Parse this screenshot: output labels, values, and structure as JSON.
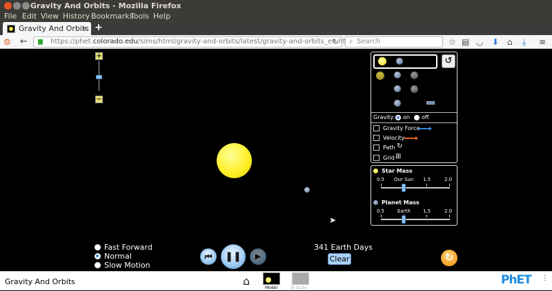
{
  "window": {
    "title": "Gravity And Orbits - Mozilla Firefox"
  },
  "menu": [
    "File",
    "Edit",
    "View",
    "History",
    "Bookmarks",
    "Tools",
    "Help"
  ],
  "tab": {
    "label": "Gravity And Orbits",
    "close": "×",
    "new_tab": "+"
  },
  "address": {
    "prefix": "https://phet.",
    "domain": "colorado.edu",
    "path": "/sims/html/gravity-and-orbits/latest/gravity-and-orbits_en.html",
    "reload": "↻"
  },
  "search": {
    "placeholder": "Search"
  },
  "zoom": {
    "plus": "+",
    "minus": "−"
  },
  "controls": {
    "gravity_label": "Gravity:",
    "gravity_on": "on",
    "gravity_off": "off",
    "gravity_value": "on",
    "checkboxes": [
      {
        "label": "Gravity Force",
        "color": "#3a86d8"
      },
      {
        "label": "Velocity",
        "color": "#e2601a"
      },
      {
        "label": "Path",
        "icon": "path-icon"
      },
      {
        "label": "Grid",
        "icon": "grid-icon"
      }
    ],
    "reset_symbol": "↺"
  },
  "mass": {
    "star_title": "Star Mass",
    "star_ticks": [
      "0.5",
      "Our Sun",
      "1.5",
      "2.0"
    ],
    "star_value": 1.0,
    "planet_title": "Planet Mass",
    "planet_ticks": [
      "0.5",
      "Earth",
      "1.5",
      "2.0"
    ],
    "planet_value": 1.0
  },
  "speed": {
    "options": [
      "Fast Forward",
      "Normal",
      "Slow Motion"
    ],
    "selected": "Normal"
  },
  "playback": {
    "rewind": "⏮",
    "pause": "❚❚",
    "step": "▶"
  },
  "time": {
    "days": "341 Earth Days",
    "clear": "Clear"
  },
  "reset_all": "↻",
  "footer": {
    "app_name": "Gravity And Orbits",
    "home": "⌂",
    "screens": [
      "Model",
      "To Scale"
    ],
    "logo": "PhET",
    "menu": "⋮"
  },
  "colors": {
    "sun": "#fff02a",
    "accent": "#8ec5f0",
    "reset_all": "#f08f10"
  }
}
